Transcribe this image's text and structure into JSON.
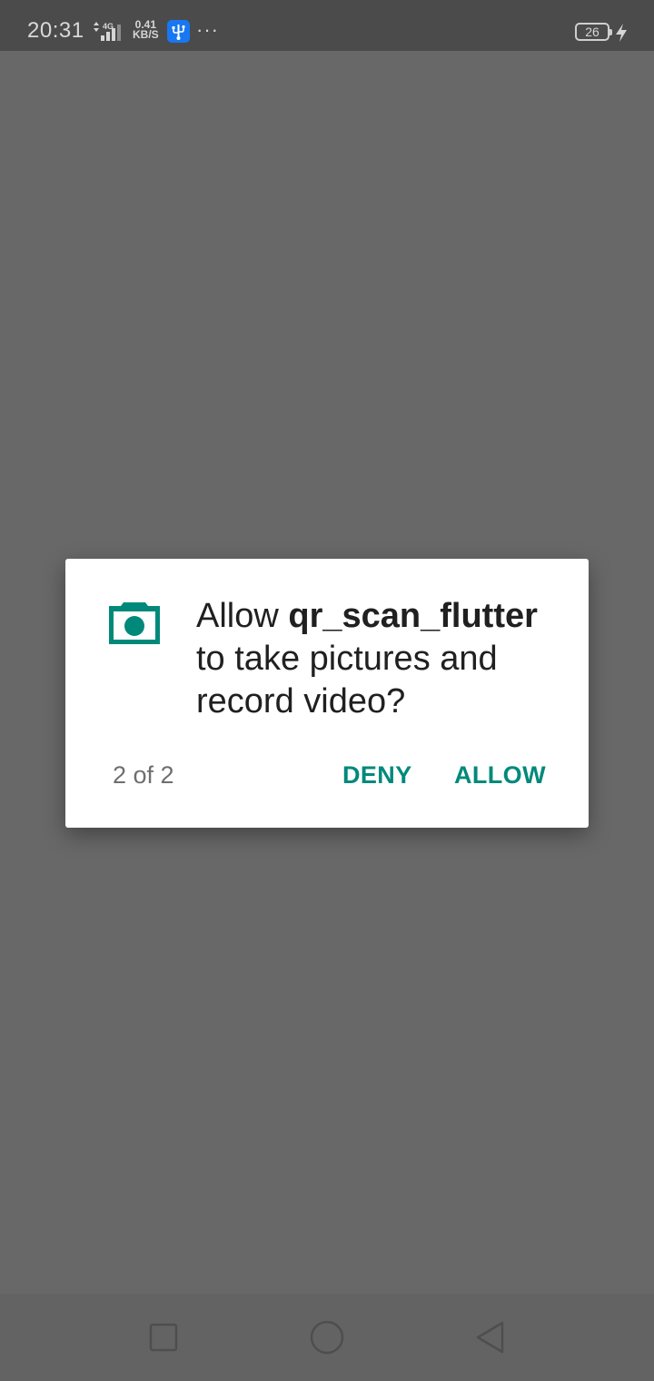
{
  "status_bar": {
    "time": "20:31",
    "network_type": "4G",
    "speed_value": "0.41",
    "speed_unit": "KB/S",
    "more": "···",
    "battery_level": "26",
    "icons": [
      "signal-icon",
      "usb-icon",
      "more-icon",
      "battery-icon",
      "charging-icon"
    ]
  },
  "dialog": {
    "message_prefix": "Allow ",
    "app_name": "qr_scan_flutter",
    "message_suffix": " to take pictures and record video?",
    "counter": "2 of 2",
    "deny_label": "DENY",
    "allow_label": "ALLOW",
    "icon": "camera-icon",
    "accent_color": "#00897b"
  },
  "nav_bar": {
    "icons": [
      "recents-square-icon",
      "home-circle-icon",
      "back-triangle-icon"
    ]
  },
  "colors": {
    "scrim": "#686868",
    "status_bar": "#4b4b4b",
    "dialog_background": "#ffffff",
    "usb_badge": "#1877f2"
  }
}
